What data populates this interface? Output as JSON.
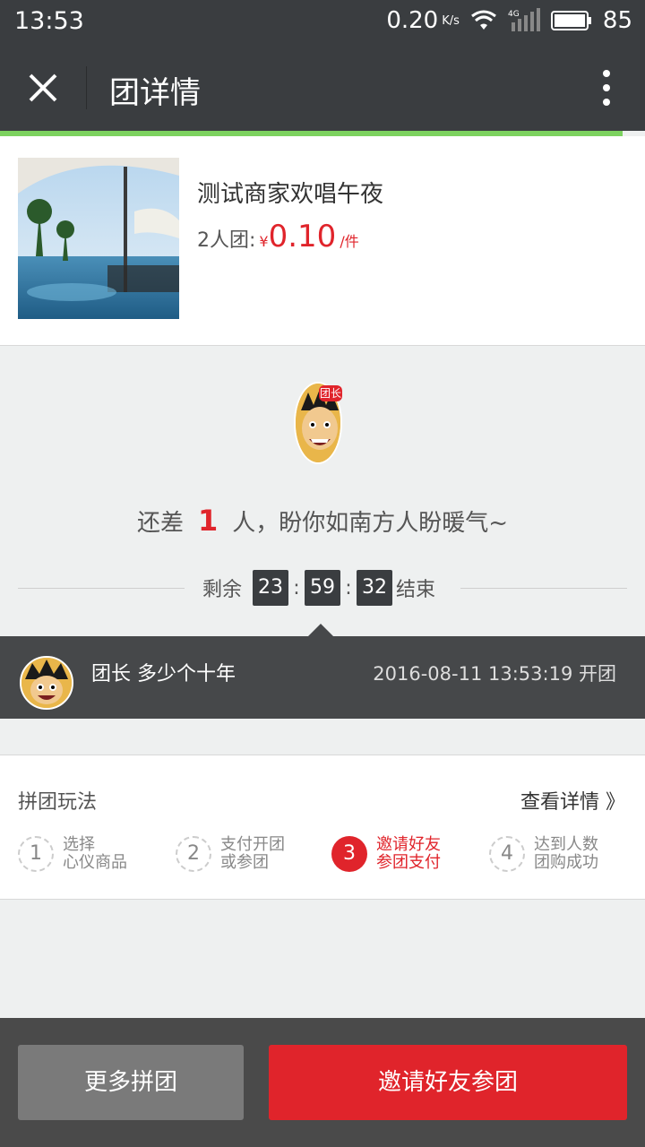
{
  "status": {
    "time": "13:53",
    "speed": "0.20",
    "speed_unit": "K/s",
    "network": "4G",
    "battery": "85"
  },
  "nav": {
    "title": "团详情",
    "close_icon": "close-icon",
    "more_icon": "more-vert-icon"
  },
  "product": {
    "name": "测试商家欢唱午夜",
    "group_label": "2人团:",
    "currency": "¥",
    "price": "0.10",
    "unit": "/件"
  },
  "leader_badge": "团长",
  "need": {
    "prefix": "还差",
    "count": "1",
    "suffix": "人，盼你如南方人盼暖气~"
  },
  "countdown": {
    "label_before": "剩余",
    "hours": "23",
    "minutes": "59",
    "seconds": "32",
    "label_after": "结束"
  },
  "member": {
    "role_name": "团长 多少个十年",
    "time_text": "2016-08-11 13:53:19 开团"
  },
  "rules": {
    "title": "拼团玩法",
    "detail_link": "查看详情 》",
    "steps": [
      {
        "num": "1",
        "line1": "选择",
        "line2": "心仪商品"
      },
      {
        "num": "2",
        "line1": "支付开团",
        "line2": "或参团"
      },
      {
        "num": "3",
        "line1": "邀请好友",
        "line2": "参团支付"
      },
      {
        "num": "4",
        "line1": "达到人数",
        "line2": "团购成功"
      }
    ]
  },
  "actions": {
    "more_groups": "更多拼团",
    "invite": "邀请好友参团"
  },
  "colors": {
    "accent": "#e0242b",
    "dark": "#3a3d40",
    "green": "#7cd25f"
  }
}
